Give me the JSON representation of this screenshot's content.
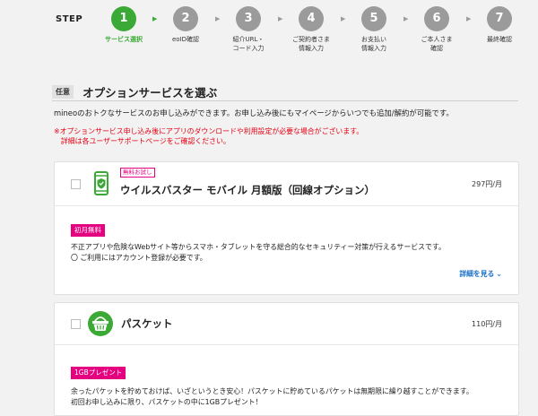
{
  "stepbar": {
    "title": "STEP",
    "steps": [
      {
        "num": "1",
        "label": "サービス選択"
      },
      {
        "num": "2",
        "label": "eoID確認"
      },
      {
        "num": "3",
        "label": "紹介URL・\nコード入力"
      },
      {
        "num": "4",
        "label": "ご契約者さま\n情報入力"
      },
      {
        "num": "5",
        "label": "お支払い\n情報入力"
      },
      {
        "num": "6",
        "label": "ご本人さま\n確認"
      },
      {
        "num": "7",
        "label": "最終確認"
      }
    ],
    "active_index": 0,
    "arrow_glyph": "▶",
    "colors": {
      "active": "#3aa935",
      "inactive": "#9b9b9b"
    }
  },
  "section": {
    "badge": "任意",
    "title": "オプションサービスを選ぶ",
    "intro": "mineoのおトクなサービスのお申し込みができます。お申し込み後にもマイページからいつでも追加/解約が可能です。",
    "notice": "※オプションサービス申し込み後にアプリのダウンロードや利用設定が必要な場合がございます。\n　詳細は各ユーザーサポートページをご確認ください。"
  },
  "options": [
    {
      "trial_tag": "無料お試し",
      "name": "ウイルスバスター モバイル 月額版（回線オプション）",
      "price": "297円/月",
      "tag": "初月無料",
      "description": "不正アプリや危険なWebサイト等からスマホ・タブレットを守る総合的なセキュリティー対策が行えるサービスです。\n〇 ご利用にはアカウント登録が必要です。",
      "more_label": "詳細を見る",
      "icon": "phone-shield-icon"
    },
    {
      "name": "パスケット",
      "price": "110円/月",
      "tag": "1GBプレゼント",
      "description": "余ったパケットを貯めておけば、いざというとき安心！パスケットに貯めているパケットは無期限に繰り越すことができます。\n初回お申し込みに限り、パスケットの中に1GBプレゼント！",
      "icon": "basket-icon"
    }
  ],
  "colors": {
    "brand_green": "#3aa935",
    "accent_pink": "#e4007f",
    "notice_red": "#e60012",
    "link_blue": "#1a6fc9"
  }
}
